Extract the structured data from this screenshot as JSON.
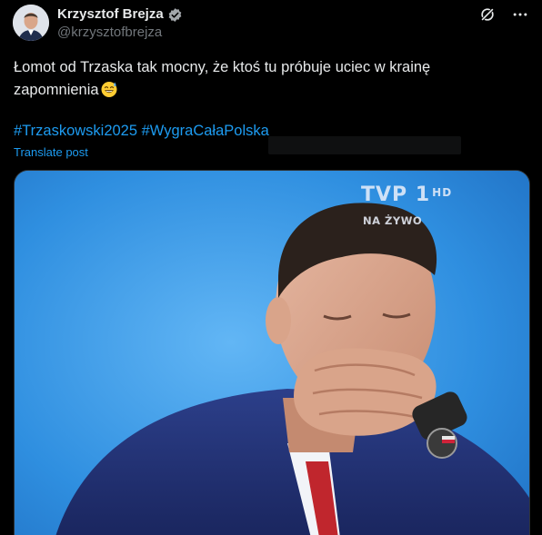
{
  "author": {
    "display_name": "Krzysztof Brejza",
    "handle": "@krzysztofbrejza",
    "verified": true
  },
  "actions": {
    "grok_icon": "grok-icon",
    "more_icon": "more-icon"
  },
  "post": {
    "text_line1": "Łomot od Trzaska tak mocny, że ktoś tu próbuje uciec w krainę",
    "text_line2": "zapomnienia",
    "emoji": "sweat-smile-emoji",
    "hashtags": [
      "#Trzaskowski2025",
      "#WygraCałaPolska"
    ],
    "translate_label": "Translate post"
  },
  "media": {
    "channel_logo": "TVP",
    "channel_number": "1",
    "channel_hd": "HD",
    "live_label": "NA ŻYWO"
  },
  "colors": {
    "background": "#000000",
    "text": "#e7e9ea",
    "secondary": "#71767b",
    "accent": "#1d9bf0"
  }
}
